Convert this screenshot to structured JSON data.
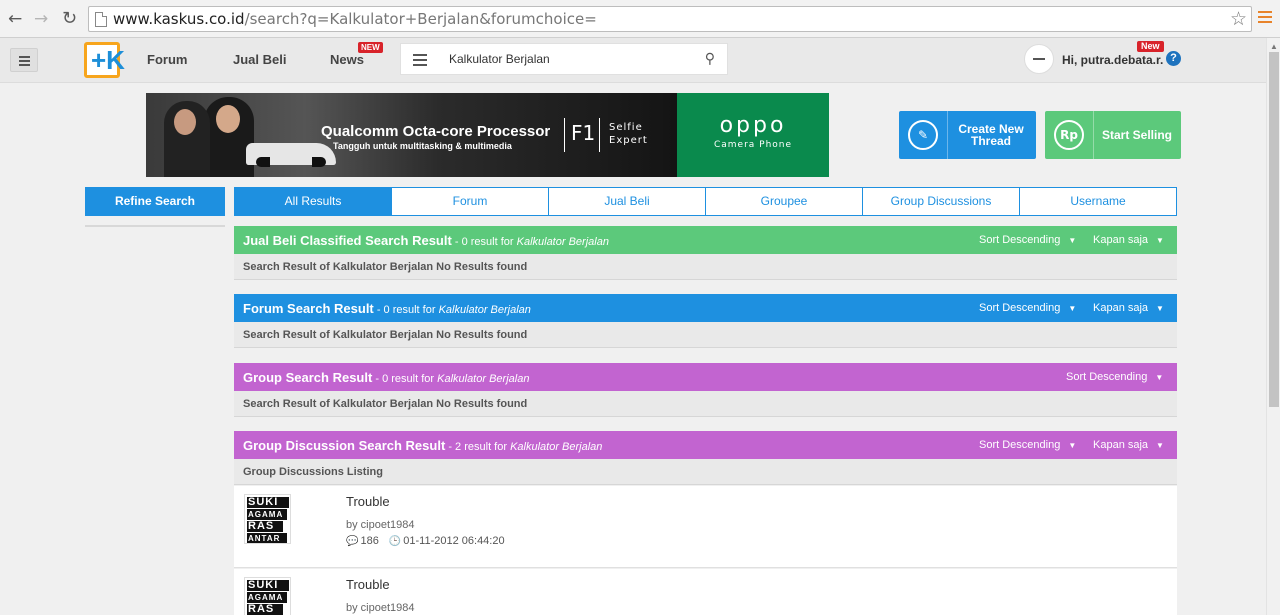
{
  "browser": {
    "url_host": "www.kaskus.co.id",
    "url_path": "/search?q=Kalkulator+Berjalan&forumchoice="
  },
  "header": {
    "nav": [
      "Forum",
      "Jual Beli",
      "News"
    ],
    "news_badge": "NEW",
    "search_value": "Kalkulator Berjalan",
    "greeting": "Hi, putra.debata.r.",
    "new_badge": "New",
    "help": "?"
  },
  "banner": {
    "headline": "Qualcomm Octa-core Processor",
    "subline": "Tangguh untuk multitasking & multimedia",
    "model": "F1",
    "model_tag_line1": "Selfie",
    "model_tag_line2": "Expert",
    "brand": "oppo",
    "brand_tag": "Camera Phone"
  },
  "actions": {
    "create_line1": "Create New",
    "create_line2": "Thread",
    "sell": "Start Selling",
    "sell_icon": "Rp"
  },
  "refine": "Refine Search",
  "tabs": [
    "All Results",
    "Forum",
    "Jual Beli",
    "Groupee",
    "Group Discussions",
    "Username"
  ],
  "sections": [
    {
      "title": "Jual Beli Classified Search Result",
      "count": " - 0 result for ",
      "query": "Kalkulator Berjalan",
      "sort": "Sort Descending",
      "time": "Kapan saja",
      "body": "Search Result of Kalkulator Berjalan No Results found",
      "color": "#5cc97b"
    },
    {
      "title": "Forum Search Result",
      "count": " - 0 result for ",
      "query": "Kalkulator Berjalan",
      "sort": "Sort Descending",
      "time": "Kapan saja",
      "body": "Search Result of Kalkulator Berjalan No Results found",
      "color": "#1e90e0"
    },
    {
      "title": "Group Search Result",
      "count": " - 0 result for ",
      "query": "Kalkulator Berjalan",
      "sort": "Sort Descending",
      "body": "Search Result of Kalkulator Berjalan No Results found",
      "color": "#c264d0"
    },
    {
      "title": "Group Discussion Search Result",
      "count": " - 2 result for ",
      "query": "Kalkulator Berjalan",
      "sort": "Sort Descending",
      "time": "Kapan saja",
      "body": "Group Discussions Listing",
      "color": "#c264d0"
    }
  ],
  "listings": [
    {
      "title": "Trouble",
      "author": "by cipoet1984",
      "comments": "186",
      "date": "01-11-2012 06:44:20",
      "thumb_lines": [
        "SUKI",
        "AGAMA",
        "RAS",
        "ANTAR"
      ]
    },
    {
      "title": "Trouble",
      "author": "by cipoet1984",
      "thumb_lines": [
        "SUKI",
        "AGAMA",
        "RAS"
      ]
    }
  ],
  "icons": {
    "back": "back-arrow-icon",
    "forward": "forward-arrow-icon",
    "reload": "reload-icon",
    "bookmark": "star-icon",
    "search": "search-icon",
    "comments": "comment-icon",
    "clock": "clock-icon",
    "pencil": "pencil-icon"
  }
}
